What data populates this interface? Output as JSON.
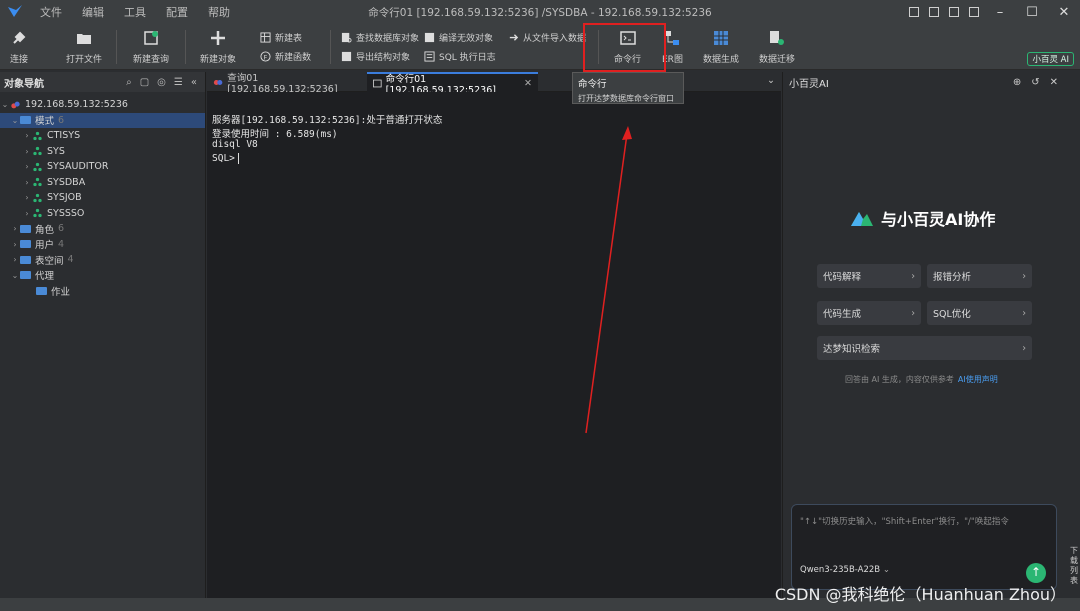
{
  "titlebar": {
    "menu": [
      "文件",
      "编辑",
      "工具",
      "配置",
      "帮助"
    ],
    "title": "命令行01 [192.168.59.132:5236] /SYSDBA  - 192.168.59.132:5236",
    "controls": {
      "minimize": "–",
      "maximize": "☐",
      "close": "✕"
    }
  },
  "toolbar": {
    "connect": "连接",
    "open_file": "打开文件",
    "new_query": "新建查询",
    "new_object": "新建对象",
    "new_table": "新建表",
    "new_function": "新建函数",
    "find_db_object": "查找数据库对象",
    "compile_invalid": "编译无效对象",
    "export_structure": "导出结构对象",
    "sql_log": "SQL 执行日志",
    "import_from_file": "从文件导入数据",
    "cmd_line": "命令行",
    "er_diagram": "ER图",
    "data_gen": "数据生成",
    "data_migration": "数据迁移",
    "ai_badge": "小百灵 AI"
  },
  "tooltip": {
    "title": "命令行",
    "desc": "打开达梦数据库命令行窗口"
  },
  "navigator": {
    "title": "对象导航",
    "server": "192.168.59.132:5236",
    "schema_folder": "模式",
    "schema_count": "6",
    "schemas": [
      "CTISYS",
      "SYS",
      "SYSAUDITOR",
      "SYSDBA",
      "SYSJOB",
      "SYSSSO"
    ],
    "roles": "角色",
    "roles_count": "6",
    "users": "用户",
    "users_count": "4",
    "tablespaces": "表空间",
    "tablespaces_count": "4",
    "agent": "代理",
    "job": "作业"
  },
  "tabs": {
    "query": "查询01 [192.168.59.132:5236]",
    "cmd": "命令行01 [192.168.59.132:5236]"
  },
  "terminal": {
    "lines": [
      "服务器[192.168.59.132:5236]:处于普通打开状态",
      "登录使用时间 : 6.589(ms)",
      "disql V8",
      "SQL>"
    ]
  },
  "ai_panel": {
    "title": "小百灵AI",
    "collab": "与小百灵AI协作",
    "buttons": [
      "代码解释",
      "报错分析",
      "代码生成",
      "SQL优化",
      "达梦知识检索"
    ],
    "disclaimer": "回答由 AI 生成，内容仅供参考",
    "disclaimer_link": "AI使用声明",
    "input_placeholder": "\"↑↓\"切换历史输入，\"Shift+Enter\"换行，\"/\"唤起指令",
    "model": "Qwen3-235B-A22B",
    "side_label": "下载列表"
  },
  "watermark": "CSDN @我科绝伦（Huanhuan Zhou）",
  "chart_data": {
    "type": "table",
    "title": "",
    "rows": [
      [
        "服务器[192.168.59.132:5236]:处于普通打开状态"
      ],
      [
        "登录使用时间 : 6.589(ms)"
      ],
      [
        "disql V8"
      ],
      [
        "SQL>"
      ]
    ]
  },
  "colors": {
    "accent": "#3b7ddd",
    "highlight": "#e02020",
    "ai_green": "#2bb673"
  }
}
